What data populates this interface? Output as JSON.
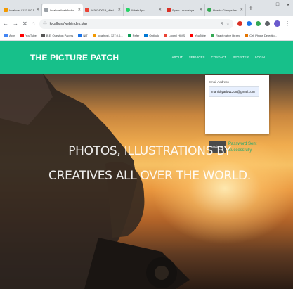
{
  "browser": {
    "tabs": [
      {
        "label": "localhost / 127.0.0.1",
        "favicon_color": "#f29900",
        "active": false
      },
      {
        "label": "localhost/web/index",
        "favicon_color": "#9aa0a6",
        "active": true
      },
      {
        "label": "1630240019_Wedde",
        "favicon_color": "#ea4335",
        "active": false
      },
      {
        "label": "WhatsApp",
        "favicon_color": "#25d366",
        "active": false
      },
      {
        "label": "Spam - manishyadav",
        "favicon_color": "#d93025",
        "active": false
      },
      {
        "label": "How to Change Ins",
        "favicon_color": "#34a853",
        "active": false
      }
    ],
    "new_tab_symbol": "+",
    "window_controls": [
      "−",
      "□",
      "✕"
    ],
    "nav": {
      "back": "←",
      "forward": "→",
      "reload": "✕",
      "home": "⌂"
    },
    "address": "localhost/web/index.php",
    "bookmarks": [
      {
        "label": "Apps",
        "color": "#4285f4"
      },
      {
        "label": "YouTube",
        "color": "#ff0000"
      },
      {
        "label": "B.E. Question Papers",
        "color": "#555555"
      },
      {
        "label": "NIT",
        "color": "#1a73e8"
      },
      {
        "label": "localhost / 127.0.0...",
        "color": "#f29900"
      },
      {
        "label": "Refer",
        "color": "#0f9d58"
      },
      {
        "label": "Outlook",
        "color": "#0078d4"
      },
      {
        "label": "Login | HIMS",
        "color": "#ea4335"
      },
      {
        "label": "YouTube",
        "color": "#ff0000"
      },
      {
        "label": "React native library",
        "color": "#34a853"
      },
      {
        "label": "Cell Phone Detectio...",
        "color": "#e37400"
      }
    ]
  },
  "site": {
    "brand": "THE PICTURE PATCH",
    "nav": [
      "ABOUT",
      "SERVICES",
      "CONTACT",
      "REGISTER",
      "LOGIN"
    ],
    "accent": "#17c08a",
    "login": {
      "email_label": "Email Address",
      "email_value": "manishyadav1208@gmail.com",
      "submit_label": "Submit",
      "message": "Password Sent Successfully."
    },
    "hero_line1": "PHOTOS, ILLUSTRATIONS BY",
    "hero_line2": "CREATIVES ALL OVER THE WORLD."
  }
}
